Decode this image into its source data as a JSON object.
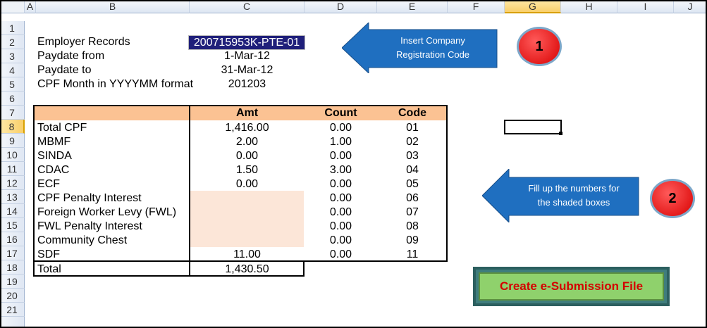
{
  "columns": [
    "A",
    "B",
    "C",
    "D",
    "E",
    "F",
    "G",
    "H",
    "I",
    "J"
  ],
  "rows": [
    "1",
    "2",
    "3",
    "4",
    "5",
    "6",
    "7",
    "8",
    "9",
    "10",
    "11",
    "12",
    "13",
    "14",
    "15",
    "16",
    "17",
    "18",
    "19",
    "20",
    "21"
  ],
  "selected_column": "G",
  "selected_row": "8",
  "header_info": {
    "employer_label": "Employer Records",
    "employer_value": "200715953K-PTE-01",
    "paydate_from_label": "Paydate from",
    "paydate_from_value": "1-Mar-12",
    "paydate_to_label": "Paydate to",
    "paydate_to_value": "31-Mar-12",
    "cpf_month_label": "CPF Month in YYYYMM format",
    "cpf_month_value": "201203"
  },
  "table": {
    "headers": {
      "amt": "Amt",
      "count": "Count",
      "code": "Code"
    },
    "rows": [
      {
        "name": "Total CPF",
        "amt": "1,416.00",
        "count": "0.00",
        "code": "01"
      },
      {
        "name": "MBMF",
        "amt": "2.00",
        "count": "1.00",
        "code": "02"
      },
      {
        "name": "SINDA",
        "amt": "0.00",
        "count": "0.00",
        "code": "03"
      },
      {
        "name": "CDAC",
        "amt": "1.50",
        "count": "3.00",
        "code": "04"
      },
      {
        "name": "ECF",
        "amt": "0.00",
        "count": "0.00",
        "code": "05"
      },
      {
        "name": "CPF Penalty Interest",
        "amt": "",
        "count": "0.00",
        "code": "06"
      },
      {
        "name": "Foreign Worker Levy (FWL)",
        "amt": "",
        "count": "0.00",
        "code": "07"
      },
      {
        "name": "FWL Penalty Interest",
        "amt": "",
        "count": "0.00",
        "code": "08"
      },
      {
        "name": "Community Chest",
        "amt": "",
        "count": "0.00",
        "code": "09"
      },
      {
        "name": "SDF",
        "amt": "11.00",
        "count": "0.00",
        "code": "11"
      }
    ],
    "total_label": "Total",
    "total_value": "1,430.50"
  },
  "callouts": {
    "c1_line1": "Insert Company",
    "c1_line2": "Registration Code",
    "c1_number": "1",
    "c2_line1": "Fill up the numbers for",
    "c2_line2": "the shaded boxes",
    "c2_number": "2"
  },
  "submit_button": "Create e-Submission  File",
  "colors": {
    "header_band": "#fbc293",
    "shaded_input": "#fce6d8",
    "arrow_fill": "#1f6fc0",
    "button_green": "#8fd16c",
    "button_text": "#d40000"
  }
}
